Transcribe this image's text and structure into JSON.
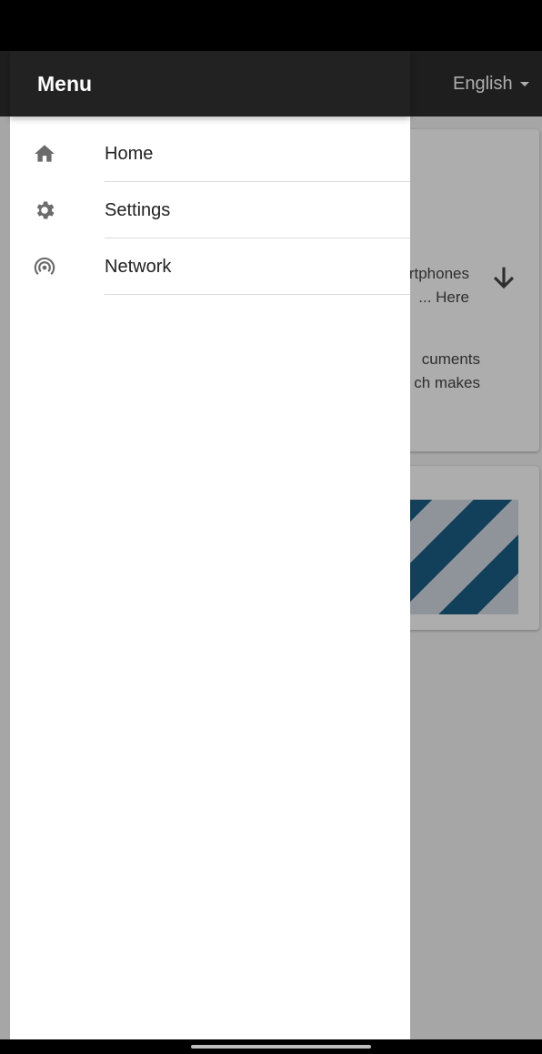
{
  "app": {
    "language_selected": "English",
    "card1_lines": [
      "rtphones",
      "... Here",
      "cuments",
      "ch makes"
    ]
  },
  "drawer": {
    "title": "Menu",
    "items": [
      {
        "label": "Home",
        "icon": "home-icon"
      },
      {
        "label": "Settings",
        "icon": "gear-icon"
      },
      {
        "label": "Network",
        "icon": "network-icon"
      }
    ]
  },
  "colors": {
    "drawer_header": "#222222",
    "app_bar": "#2d2d2d",
    "icon_gray": "#6b6b6b",
    "stripe_blue": "#1b5d84"
  }
}
